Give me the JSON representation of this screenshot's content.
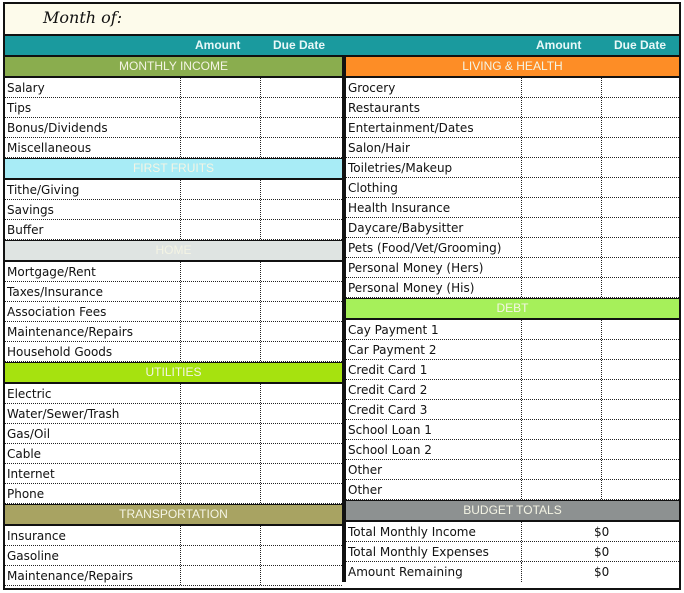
{
  "title": "Month of:",
  "column_headers": {
    "amount": "Amount",
    "due_date": "Due Date"
  },
  "colors": {
    "header_teal": "#1a9a9e",
    "monthly_income": "#8aad4e",
    "first_fruits": "#a8ecf6",
    "home": "#dfe4e2",
    "utilities": "#a6e20f",
    "transportation": "#a8a362",
    "living_health": "#fd8d26",
    "debt": "#a6f05a",
    "budget_totals": "#8d9191"
  },
  "left": [
    {
      "title": "MONTHLY INCOME",
      "color": "#8aad4e",
      "items": [
        "Salary",
        "Tips",
        "Bonus/Dividends",
        "Miscellaneous"
      ]
    },
    {
      "title": "FIRST FRUITS",
      "color": "#a8ecf6",
      "items": [
        "Tithe/Giving",
        "Savings",
        "Buffer"
      ]
    },
    {
      "title": "HOME",
      "color": "#dfe4e2",
      "items": [
        "Mortgage/Rent",
        "Taxes/Insurance",
        "Association Fees",
        "Maintenance/Repairs",
        "Household Goods"
      ]
    },
    {
      "title": "UTILITIES",
      "color": "#a6e20f",
      "items": [
        "Electric",
        "Water/Sewer/Trash",
        "Gas/Oil",
        "Cable",
        "Internet",
        "Phone"
      ]
    },
    {
      "title": "TRANSPORTATION",
      "color": "#a8a362",
      "items": [
        "Insurance",
        "Gasoline",
        "Maintenance/Repairs"
      ]
    }
  ],
  "right": [
    {
      "title": "LIVING & HEALTH",
      "color": "#fd8d26",
      "items": [
        "Grocery",
        "Restaurants",
        "Entertainment/Dates",
        "Salon/Hair",
        "Toiletries/Makeup",
        "Clothing",
        "Health Insurance",
        "Daycare/Babysitter",
        "Pets (Food/Vet/Grooming)",
        "Personal Money (Hers)",
        "Personal Money (His)"
      ]
    },
    {
      "title": "DEBT",
      "color": "#a6f05a",
      "items": [
        "Cay Payment 1",
        "Car Payment 2",
        "Credit Card 1",
        "Credit Card 2",
        "Credit Card 3",
        "School Loan 1",
        "School Loan 2",
        "Other",
        "Other"
      ]
    },
    {
      "title": "BUDGET TOTALS",
      "color": "#8d9191",
      "totals": [
        {
          "label": "Total Monthly Income",
          "value": "$0"
        },
        {
          "label": "Total Monthly Expenses",
          "value": "$0"
        },
        {
          "label": "Amount Remaining",
          "value": "$0"
        }
      ]
    }
  ]
}
